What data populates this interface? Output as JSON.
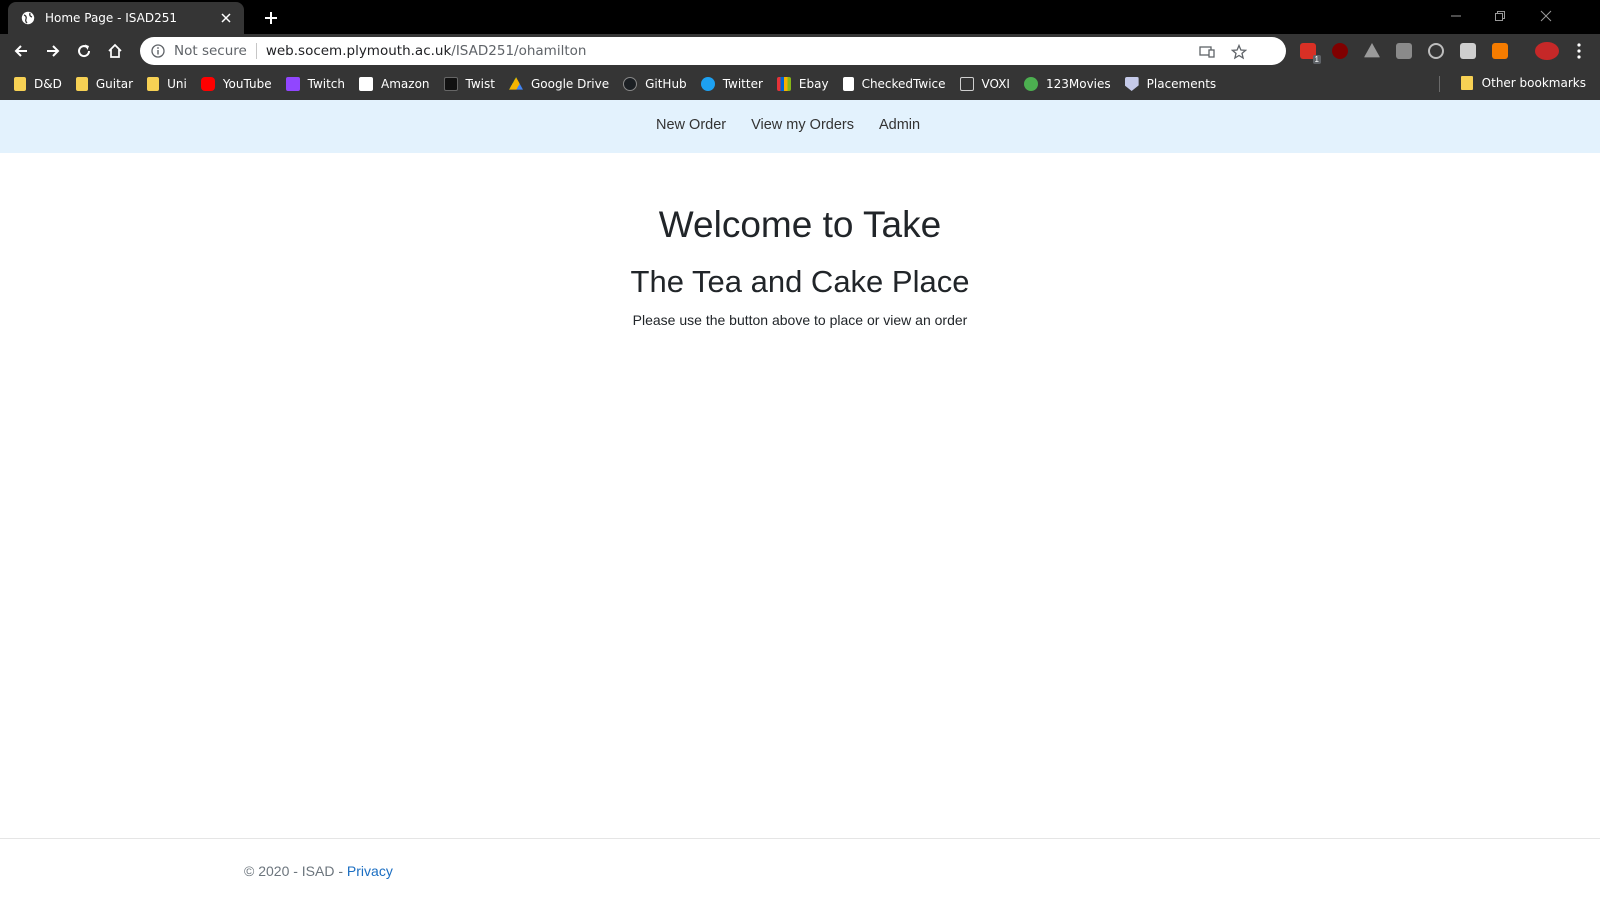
{
  "browser": {
    "tab_title": "Home Page - ISAD251",
    "secure_label": "Not secure",
    "url_host": "web.socem.plymouth.ac.uk",
    "url_path": "/ISAD251/ohamilton",
    "bookmarks": [
      {
        "label": "D&D",
        "icon": "folder-icon"
      },
      {
        "label": "Guitar",
        "icon": "folder-icon"
      },
      {
        "label": "Uni",
        "icon": "folder-icon"
      },
      {
        "label": "YouTube",
        "icon": "youtube-icon"
      },
      {
        "label": "Twitch",
        "icon": "twitch-icon"
      },
      {
        "label": "Amazon",
        "icon": "amazon-icon"
      },
      {
        "label": "Twist",
        "icon": "twist-icon"
      },
      {
        "label": "Google Drive",
        "icon": "google-drive-icon"
      },
      {
        "label": "GitHub",
        "icon": "github-icon"
      },
      {
        "label": "Twitter",
        "icon": "twitter-icon"
      },
      {
        "label": "Ebay",
        "icon": "ebay-icon"
      },
      {
        "label": "CheckedTwice",
        "icon": "checkedtwice-icon"
      },
      {
        "label": "VOXI",
        "icon": "voxi-icon"
      },
      {
        "label": "123Movies",
        "icon": "play-icon"
      },
      {
        "label": "Placements",
        "icon": "shield-icon"
      }
    ],
    "other_bookmarks": "Other bookmarks",
    "extension_badge": "1",
    "colors": {
      "tabstrip": "#000000",
      "toolbar": "#353535",
      "folder": "#f7d154"
    }
  },
  "site": {
    "nav": {
      "new_order": "New Order",
      "view_orders": "View my Orders",
      "admin": "Admin"
    },
    "hero": {
      "title": "Welcome to Take",
      "subtitle": "The Tea and Cake Place",
      "text": "Please use the button above to place or view an order"
    },
    "footer": {
      "copyright": "© 2020 - ISAD - ",
      "privacy": "Privacy"
    },
    "colors": {
      "nav_bg": "#e3f2fd",
      "link": "#1b6ec2"
    }
  }
}
